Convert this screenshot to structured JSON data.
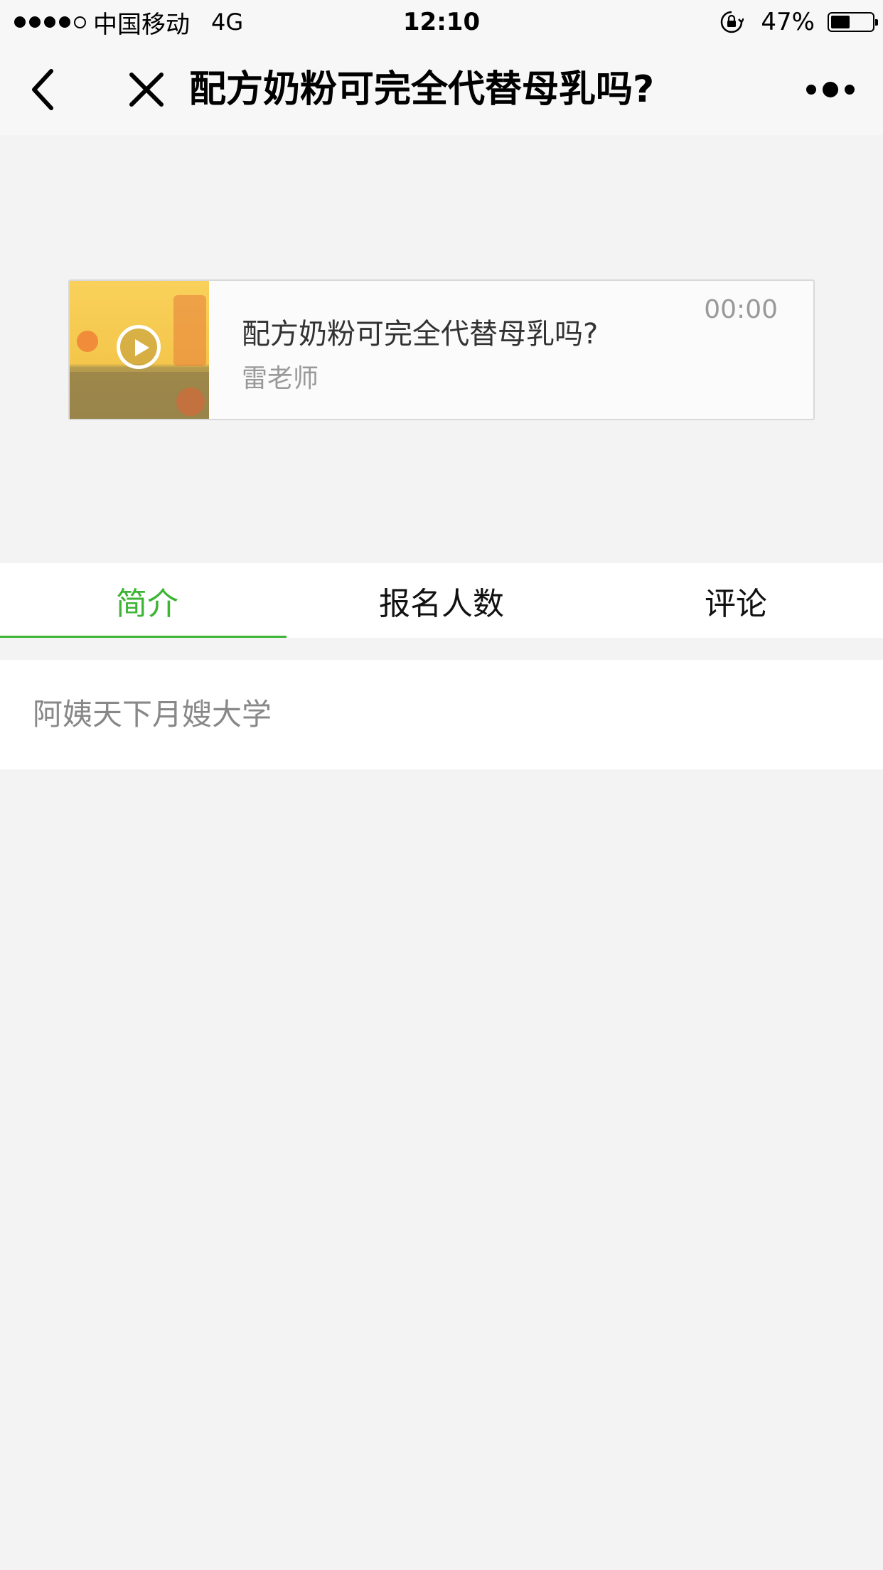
{
  "status_bar": {
    "carrier": "中国移动",
    "network": "4G",
    "time": "12:10",
    "battery_percent": "47%",
    "battery_level": 0.47,
    "signal_bars_filled": 4,
    "signal_bars_total": 5
  },
  "nav": {
    "title": "配方奶粉可完全代替母乳吗?",
    "back_icon": "chevron-left-icon",
    "close_icon": "close-icon",
    "more_icon": "more-icon"
  },
  "audio_card": {
    "title": "配方奶粉可完全代替母乳吗?",
    "author": "雷老师",
    "time": "00:00",
    "play_icon": "play-icon"
  },
  "tabs": [
    {
      "label": "简介",
      "active": true
    },
    {
      "label": "报名人数",
      "active": false
    },
    {
      "label": "评论",
      "active": false
    }
  ],
  "intro": {
    "text": "阿姨天下月嫂大学"
  },
  "colors": {
    "accent": "#3cb534",
    "background": "#f3f3f4",
    "nav_background": "#f7f7f7"
  }
}
